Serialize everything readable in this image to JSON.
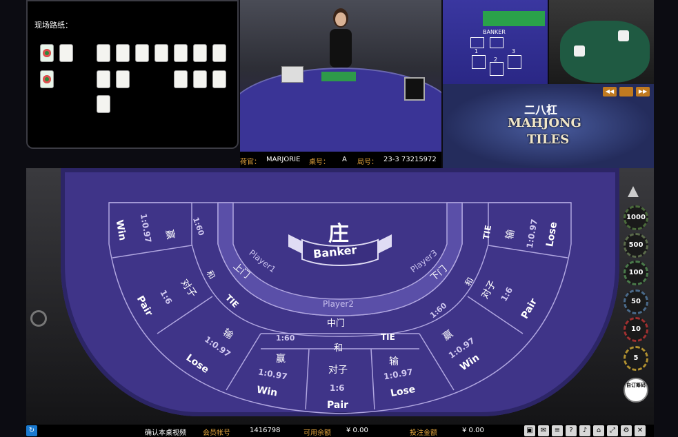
{
  "roadmap": {
    "title": "现场路纸："
  },
  "info": {
    "dealer_label": "荷官：",
    "dealer": "MARJORIE",
    "table_label": "桌号：",
    "table": "A",
    "round_label": "局号：",
    "round": "23-3 73215972"
  },
  "cam": {
    "banker_label": "BANKER",
    "spots": [
      "1",
      "2",
      "3"
    ]
  },
  "logo": {
    "cn": "二八杠",
    "en1": "MAHJONG",
    "en2": "TILES"
  },
  "bets": {
    "banker_cn": "庄",
    "banker_en": "Banker",
    "p1_en": "Player1",
    "p1_cn": "上门",
    "p2_en": "Player2",
    "p2_cn": "中门",
    "p3_en": "Player3",
    "p3_cn": "下门",
    "win_cn": "赢",
    "win_en": "Win",
    "win_odds": "1:0.97",
    "tie_cn": "和",
    "tie_en": "TIE",
    "tie_odds": "1:60",
    "pair_cn": "对子",
    "pair_en": "Pair",
    "pair_odds": "1:6",
    "lose_cn": "输",
    "lose_en": "Lose",
    "lose_odds": "1:0.97"
  },
  "chips": [
    "1000",
    "500",
    "100",
    "50",
    "10",
    "5"
  ],
  "custom_chip": "自订筹码",
  "status": {
    "confirm": "确认本桌视频",
    "member_label": "会员帐号",
    "member": "1416798",
    "balance_label": "可用余额",
    "balance": "¥ 0.00",
    "bet_label": "投注金额",
    "bet": "¥ 0.00"
  }
}
